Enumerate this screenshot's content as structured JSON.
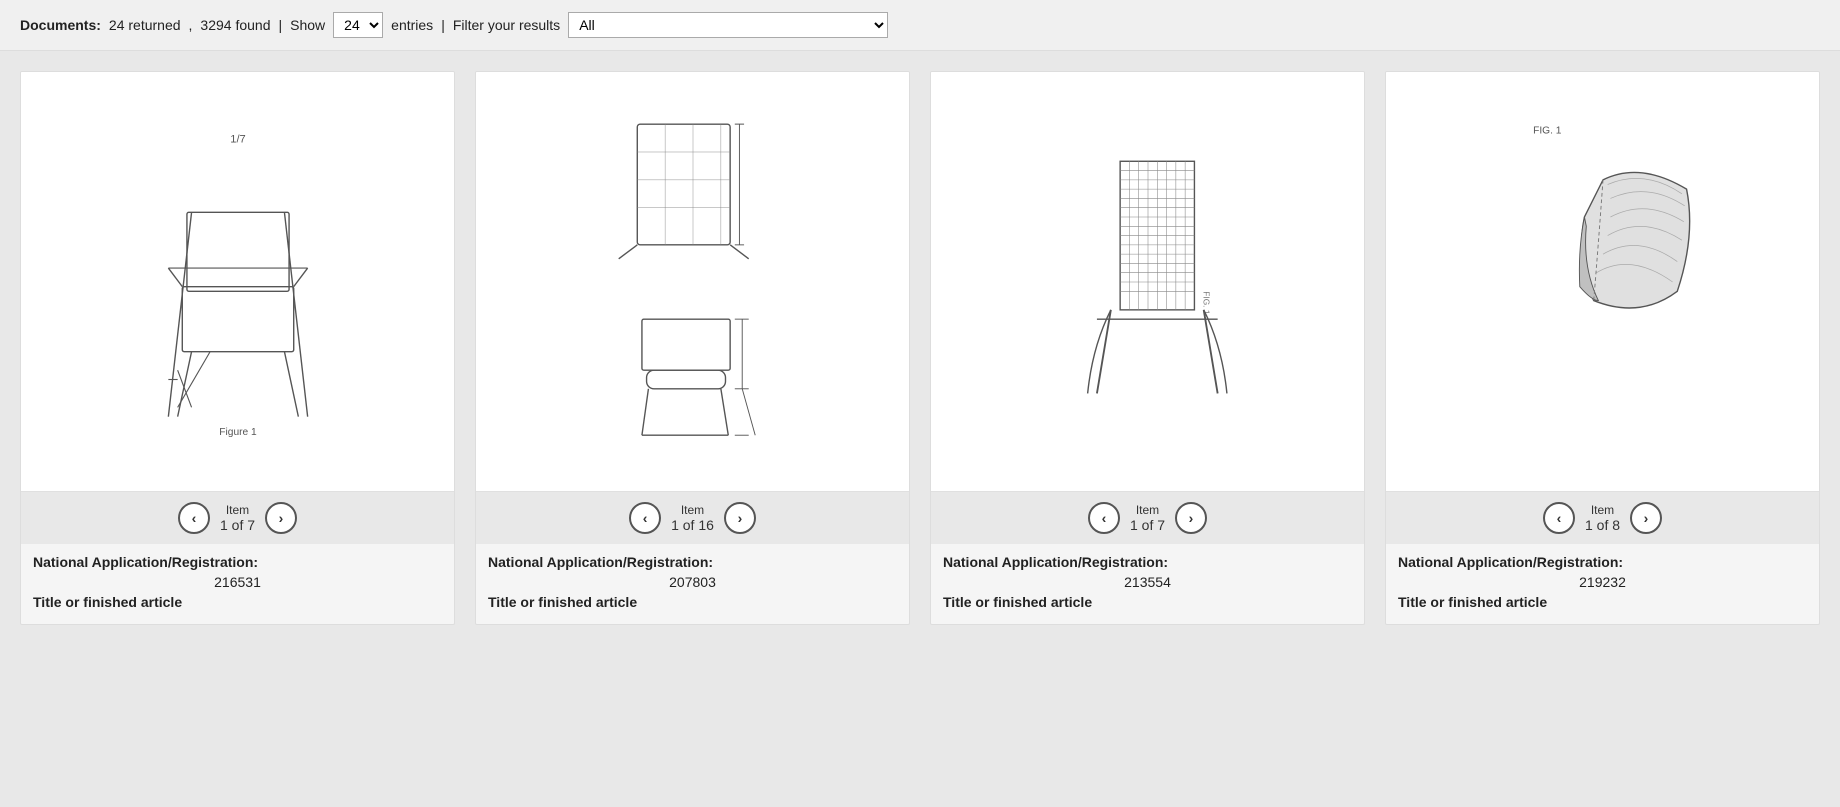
{
  "topbar": {
    "documents_label": "Documents:",
    "returned_text": "24 returned",
    "found_text": "3294 found",
    "show_label": "Show",
    "show_value": "24",
    "entries_label": "entries",
    "filter_label": "Filter your results",
    "filter_value": "All",
    "filter_options": [
      "All"
    ]
  },
  "cards": [
    {
      "id": "card-1",
      "item_label": "Item",
      "item_current": "1",
      "item_total": "7",
      "title": "National Application/Registration:",
      "reg_num": "216531",
      "subtitle": "Title or finished article"
    },
    {
      "id": "card-2",
      "item_label": "Item",
      "item_current": "1",
      "item_total": "16",
      "title": "National Application/Registration:",
      "reg_num": "207803",
      "subtitle": "Title or finished article"
    },
    {
      "id": "card-3",
      "item_label": "Item",
      "item_current": "1",
      "item_total": "7",
      "title": "National Application/Registration:",
      "reg_num": "213554",
      "subtitle": "Title or finished article"
    },
    {
      "id": "card-4",
      "item_label": "Item",
      "item_current": "1",
      "item_total": "8",
      "title": "National Application/Registration:",
      "reg_num": "219232",
      "subtitle": "Title or finished article"
    }
  ]
}
